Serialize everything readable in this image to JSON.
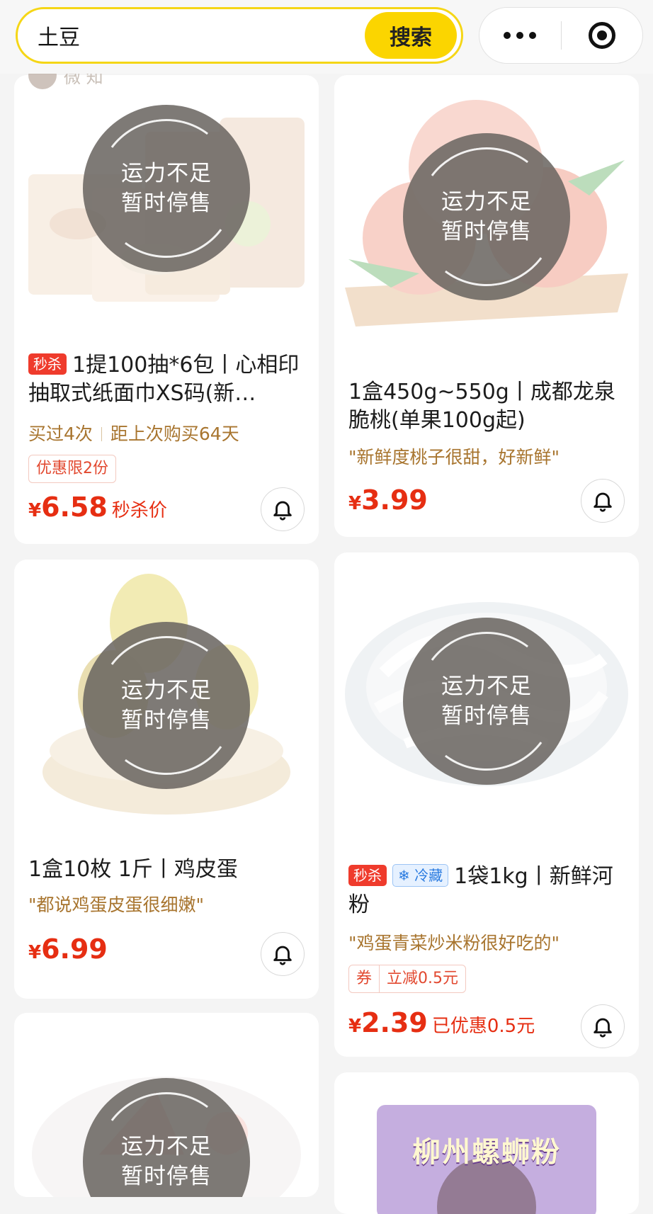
{
  "search": {
    "query": "土豆",
    "button_label": "搜索"
  },
  "capsule": {
    "more_icon": "more-dots-icon",
    "close_icon": "target-icon"
  },
  "partial_header": "微 知",
  "sold_out": {
    "line1": "运力不足",
    "line2": "暂时停售"
  },
  "products": [
    {
      "tag": "秒杀",
      "title": "1提100抽*6包丨心相印抽取式纸面巾XS码(新…",
      "bought": "买过4次",
      "last": "距上次购买64天",
      "promo": "优惠限2份",
      "currency": "¥",
      "price": "6.58",
      "price_note": "秒杀价"
    },
    {
      "title": "1盒450g~550g丨成都龙泉脆桃(单果100g起)",
      "review": "\"新鲜度桃子很甜，好新鲜\"",
      "currency": "¥",
      "price": "3.99"
    },
    {
      "title": "1盒10枚 1斤丨鸡皮蛋",
      "review": "\"都说鸡蛋皮蛋很细嫩\"",
      "currency": "¥",
      "price": "6.99"
    },
    {
      "tag": "秒杀",
      "tag2": "冷藏",
      "title": "1袋1kg丨新鲜河粉",
      "review": "\"鸡蛋青菜炒米粉很好吃的\"",
      "coupon": "券",
      "promo": "立减0.5元",
      "currency": "¥",
      "price": "2.39",
      "price_note": "已优惠0.5元"
    }
  ],
  "bottom_banner": {
    "brand": "柳州螺蛳粉"
  },
  "colors": {
    "accent": "#fbd500",
    "price": "#e62e12",
    "review": "#a8752f",
    "tag": "#ef3b2c"
  }
}
